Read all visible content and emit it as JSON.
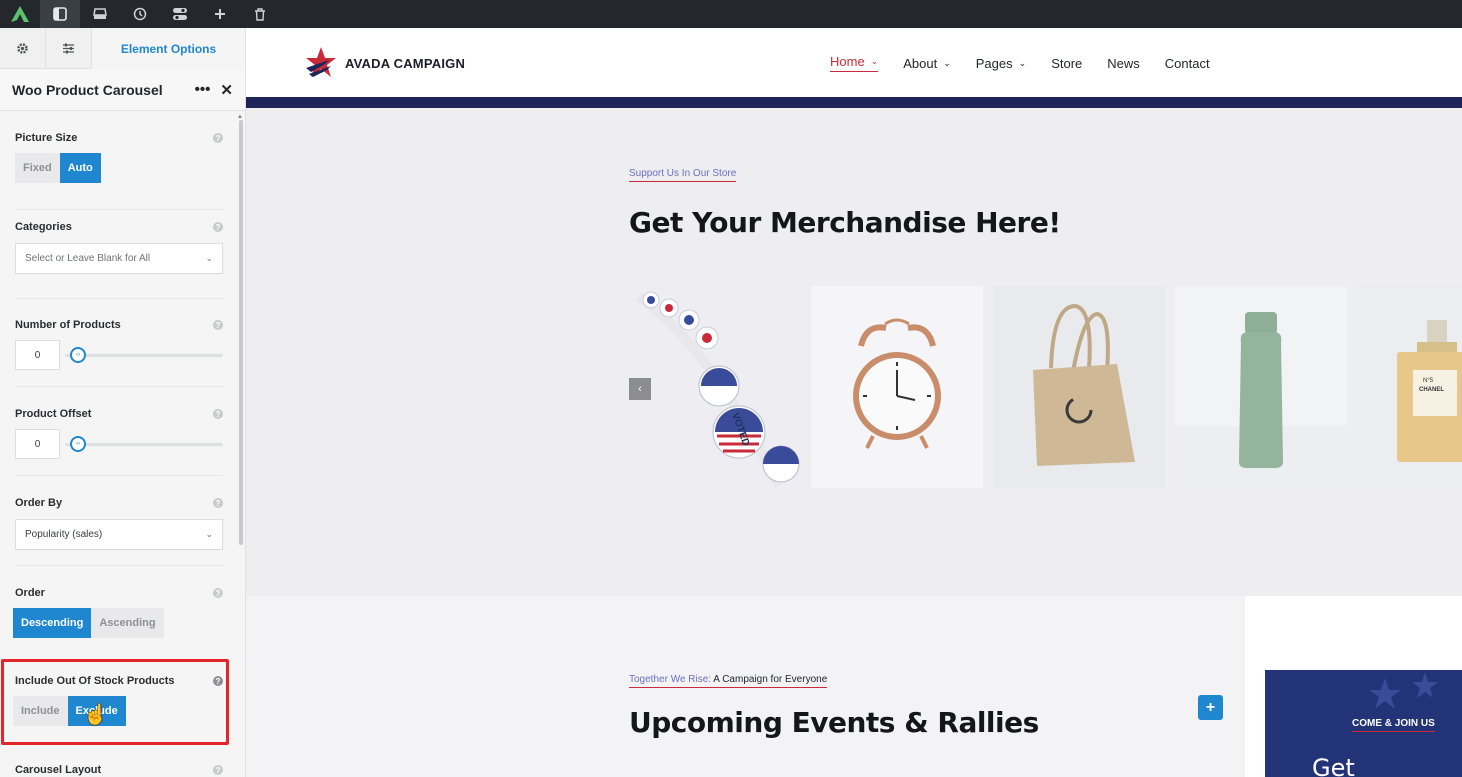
{
  "toolbar": {
    "icons": [
      "avada-logo-icon",
      "sidebar-toggle-icon",
      "library-icon",
      "history-icon",
      "toggles-icon",
      "add-icon",
      "trash-icon"
    ]
  },
  "sidebar": {
    "tab_main": "Element Options",
    "header_title": "Woo Product Carousel",
    "picture_size": {
      "label": "Picture Size",
      "options": [
        "Fixed",
        "Auto"
      ],
      "selected": "Auto"
    },
    "categories": {
      "label": "Categories",
      "placeholder": "Select or Leave Blank for All"
    },
    "num_products": {
      "label": "Number of Products",
      "value": "0"
    },
    "product_offset": {
      "label": "Product Offset",
      "value": "0"
    },
    "order_by": {
      "label": "Order By",
      "value": "Popularity (sales)"
    },
    "order": {
      "label": "Order",
      "options": [
        "Descending",
        "Ascending"
      ],
      "selected": "Descending"
    },
    "stock": {
      "label": "Include Out Of Stock Products",
      "options": [
        "Include",
        "Exclude"
      ],
      "selected": "Exclude"
    },
    "carousel_layout": {
      "label": "Carousel Layout"
    }
  },
  "site": {
    "logo_text": "AVADA CAMPAIGN",
    "nav": [
      "Home",
      "About",
      "Pages",
      "Store",
      "News",
      "Contact"
    ],
    "store_eyebrow": "Support Us In Our Store",
    "store_heading": "Get Your Merchandise Here!",
    "products": [
      "stickers",
      "alarm-clock",
      "tote-bag",
      "water-bottle",
      "perfume"
    ],
    "perfume_label_1": "N°5",
    "perfume_label_2": "CHANEL",
    "sticker_text": "VOTED",
    "events_eyebrow_highlight": "Together We Rise:",
    "events_eyebrow_rest": " A Campaign for Everyone",
    "events_heading": "Upcoming Events & Rallies",
    "join_label": "COME & JOIN US",
    "join_big": "Get Involved"
  },
  "colors": {
    "accent": "#1f86d0",
    "brand_red": "#c92b3a",
    "navy": "#1d2458",
    "highlight": "#e3262b"
  }
}
